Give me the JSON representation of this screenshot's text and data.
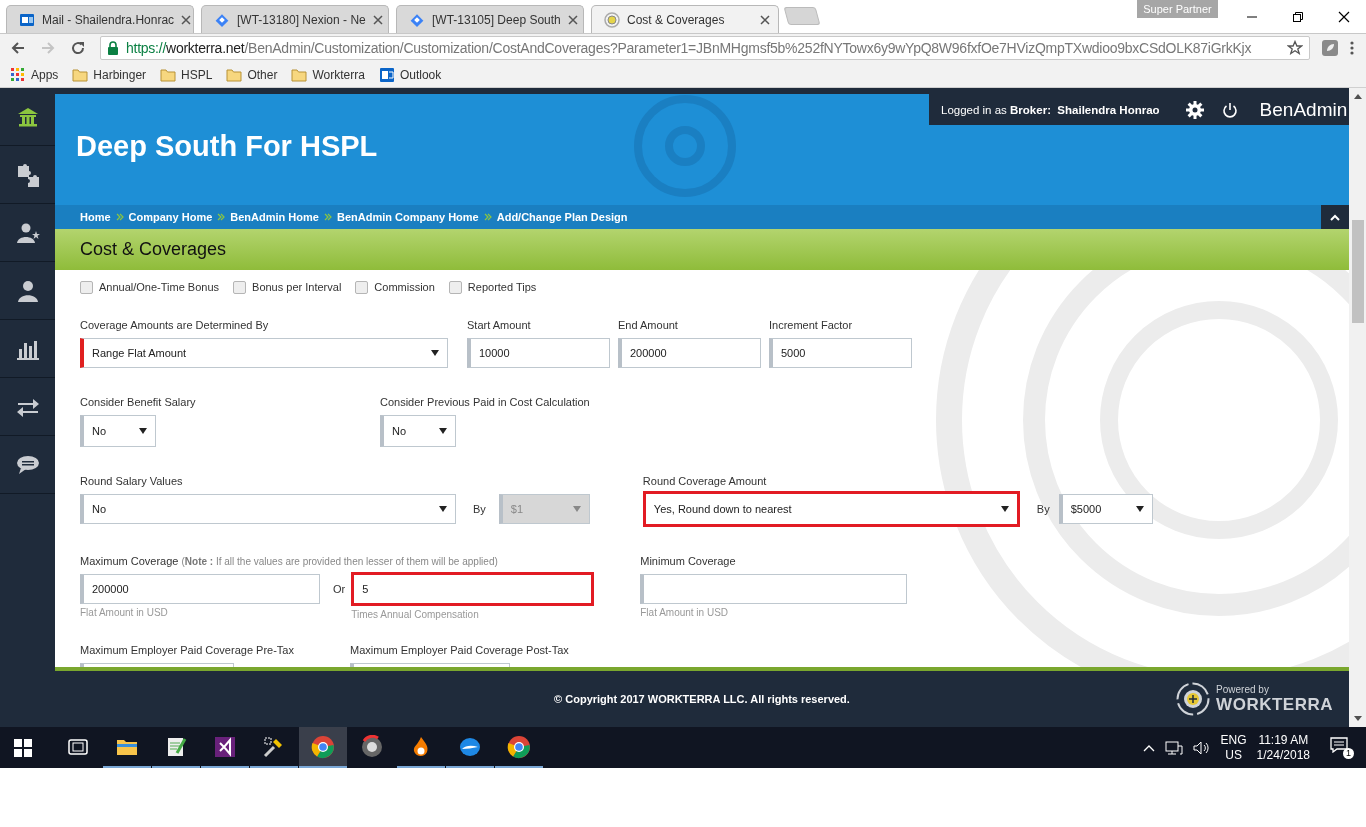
{
  "browser": {
    "tabs": [
      {
        "title": "Mail - Shailendra.Honrac",
        "selected": false
      },
      {
        "title": "[WT-13180] Nexion - Ne",
        "selected": false
      },
      {
        "title": "[WT-13105] Deep South",
        "selected": false
      },
      {
        "title": "Cost & Coverages",
        "selected": true
      }
    ],
    "profile_badge": "Super Partner",
    "address": {
      "scheme": "https://",
      "host": "workterra.net",
      "path": "/BenAdmin/Customization/Customization/CostAndCoverages?Parameter1=JBnMHgmsf5b%252fNYTowx6y9wYpQ8W96fxfOe7HVizQmpTXwdioo9bxCSdOLK87iGrkKjx"
    },
    "bookmarks": [
      {
        "kind": "apps",
        "label": "Apps"
      },
      {
        "kind": "folder",
        "label": "Harbinger"
      },
      {
        "kind": "folder",
        "label": "HSPL"
      },
      {
        "kind": "folder",
        "label": "Other"
      },
      {
        "kind": "folder",
        "label": "Workterra"
      },
      {
        "kind": "mail",
        "label": "Outlook"
      }
    ]
  },
  "sidebar": {
    "items": [
      {
        "selected": true
      },
      {
        "selected": false
      },
      {
        "selected": false
      },
      {
        "selected": false
      },
      {
        "selected": false
      },
      {
        "selected": false
      },
      {
        "selected": false
      }
    ]
  },
  "header": {
    "user": {
      "prefix": "Logged in as",
      "role": "Broker:",
      "name": "Shailendra Honrao"
    },
    "app_name": "BenAdmin",
    "company": "Deep South For HSPL",
    "breadcrumbs": [
      "Home",
      "Company Home",
      "BenAdmin Home",
      "BenAdmin Company Home",
      "Add/Change Plan Design"
    ]
  },
  "section_title": "Cost & Coverages",
  "options": [
    {
      "label": "Annual/One-Time Bonus",
      "checked": false
    },
    {
      "label": "Bonus per Interval",
      "checked": false
    },
    {
      "label": "Commission",
      "checked": false
    },
    {
      "label": "Reported Tips",
      "checked": false
    }
  ],
  "form_rows": [
    [
      {
        "kind": "select",
        "label": "Coverage Amounts are Determined By",
        "value": "Range Flat Amount",
        "required": true,
        "highlighted": false,
        "disabled": false
      },
      {
        "kind": "input",
        "label": "Start Amount",
        "value": "10000",
        "required": false,
        "highlighted": false,
        "disabled": false
      },
      {
        "kind": "input",
        "label": "End Amount",
        "value": "200000",
        "required": false,
        "highlighted": false,
        "disabled": false
      },
      {
        "kind": "input",
        "label": "Increment Factor",
        "value": "5000",
        "required": false,
        "highlighted": false,
        "disabled": false
      }
    ],
    [
      {
        "kind": "select",
        "label": "Consider Benefit Salary",
        "value": "No",
        "required": false,
        "highlighted": false,
        "disabled": false
      },
      {
        "kind": "select",
        "label": "Consider Previous Paid in Cost Calculation",
        "value": "No",
        "required": false,
        "highlighted": false,
        "disabled": false
      }
    ],
    [
      {
        "kind": "select",
        "label": "Round Salary Values",
        "value": "No",
        "required": false,
        "highlighted": false,
        "disabled": false
      },
      {
        "kind": "text",
        "text": "By"
      },
      {
        "kind": "select",
        "value": "$1",
        "required": false,
        "highlighted": false,
        "disabled": true
      },
      {
        "kind": "select",
        "label": "Round Coverage Amount",
        "value": "Yes, Round down to nearest",
        "required": false,
        "highlighted": true,
        "disabled": false
      },
      {
        "kind": "text",
        "text": "By"
      },
      {
        "kind": "select",
        "value": "$5000",
        "required": false,
        "highlighted": false,
        "disabled": false
      }
    ],
    [
      {
        "kind": "input",
        "label": "Maximum Coverage",
        "note": "(**Note :** If all the values are provided then lesser of them will be applied)",
        "value": "200000",
        "hint": "Flat Amount in USD",
        "required": false,
        "highlighted": false,
        "disabled": false
      },
      {
        "kind": "text",
        "text": "Or"
      },
      {
        "kind": "input",
        "value": "5",
        "hint": "Times Annual Compensation",
        "required": false,
        "highlighted": true,
        "disabled": false
      },
      {
        "kind": "input",
        "label": "Minimum Coverage",
        "hint": "Flat Amount in USD",
        "required": false,
        "highlighted": false,
        "disabled": false
      }
    ],
    [
      {
        "kind": "input",
        "label": "Maximum Employer Paid Coverage Pre-Tax"
      },
      {
        "kind": "input",
        "label": "Maximum Employer Paid Coverage Post-Tax"
      }
    ]
  ],
  "footer": {
    "copyright": "© Copyright 2017 WORKTERRA LLC. All rights reserved.",
    "powered_by": "Powered by",
    "brand": "WORKTERRA"
  },
  "taskbar": {
    "apps": [
      {
        "selected": false,
        "running": false
      },
      {
        "selected": false,
        "running": true
      },
      {
        "selected": false,
        "running": true
      },
      {
        "selected": false,
        "running": true
      },
      {
        "selected": false,
        "running": true
      },
      {
        "selected": true,
        "running": true
      },
      {
        "selected": false,
        "running": false
      },
      {
        "selected": false,
        "running": true
      },
      {
        "selected": false,
        "running": true
      },
      {
        "selected": false,
        "running": true
      }
    ],
    "language": "ENG",
    "region": "US",
    "time": "11:19 AM",
    "date": "1/24/2018",
    "notifications": "1"
  }
}
